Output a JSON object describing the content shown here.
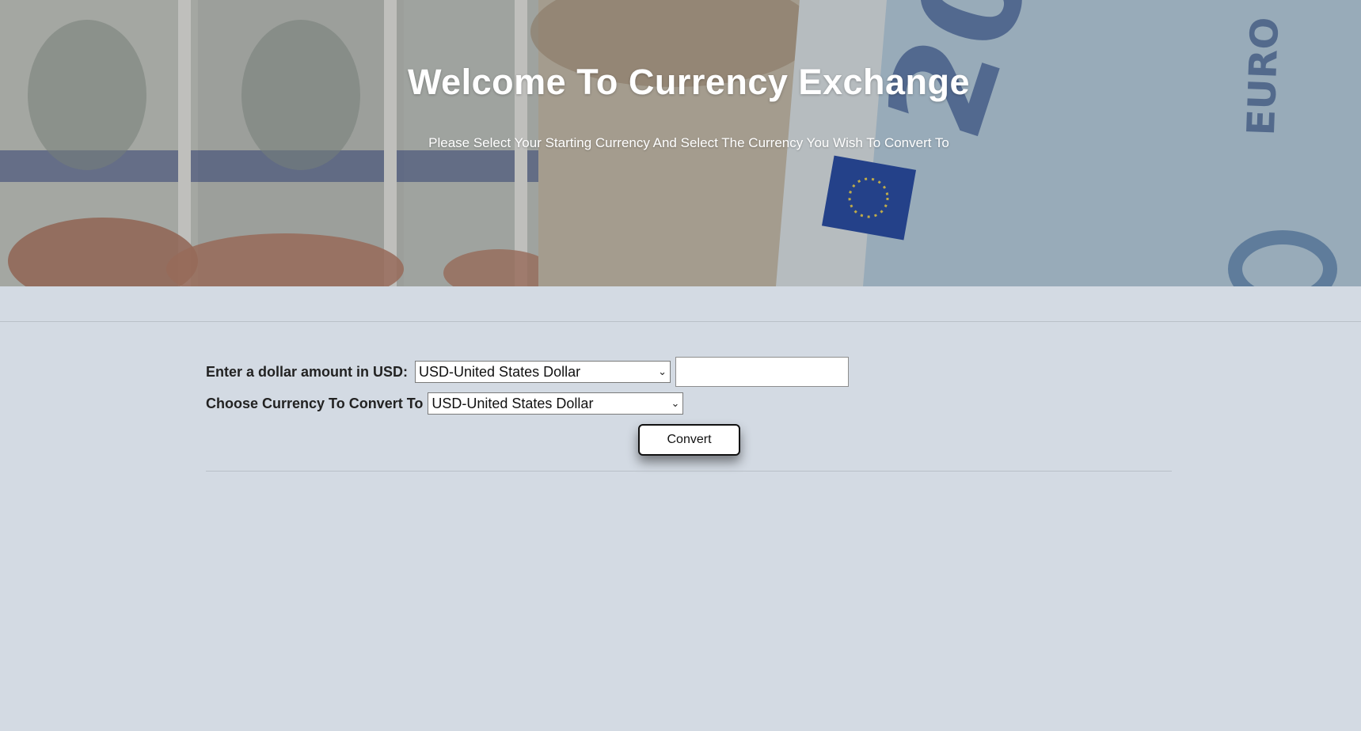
{
  "hero": {
    "title": "Welcome To Currency Exchange",
    "subtitle": "Please Select Your Starting Currency And Select The Currency You Wish To Convert To"
  },
  "form": {
    "amount_label": "Enter a dollar amount in USD:",
    "from_currency_selected": "USD-United States Dollar",
    "amount_value": "",
    "convert_to_label": "Choose Currency To Convert To",
    "to_currency_selected": "USD-United States Dollar",
    "convert_label": "Convert"
  },
  "icons": {
    "dropdown": "chevron-down-icon"
  },
  "colors": {
    "page_background": "#d3dae3",
    "button_border": "#111111"
  }
}
